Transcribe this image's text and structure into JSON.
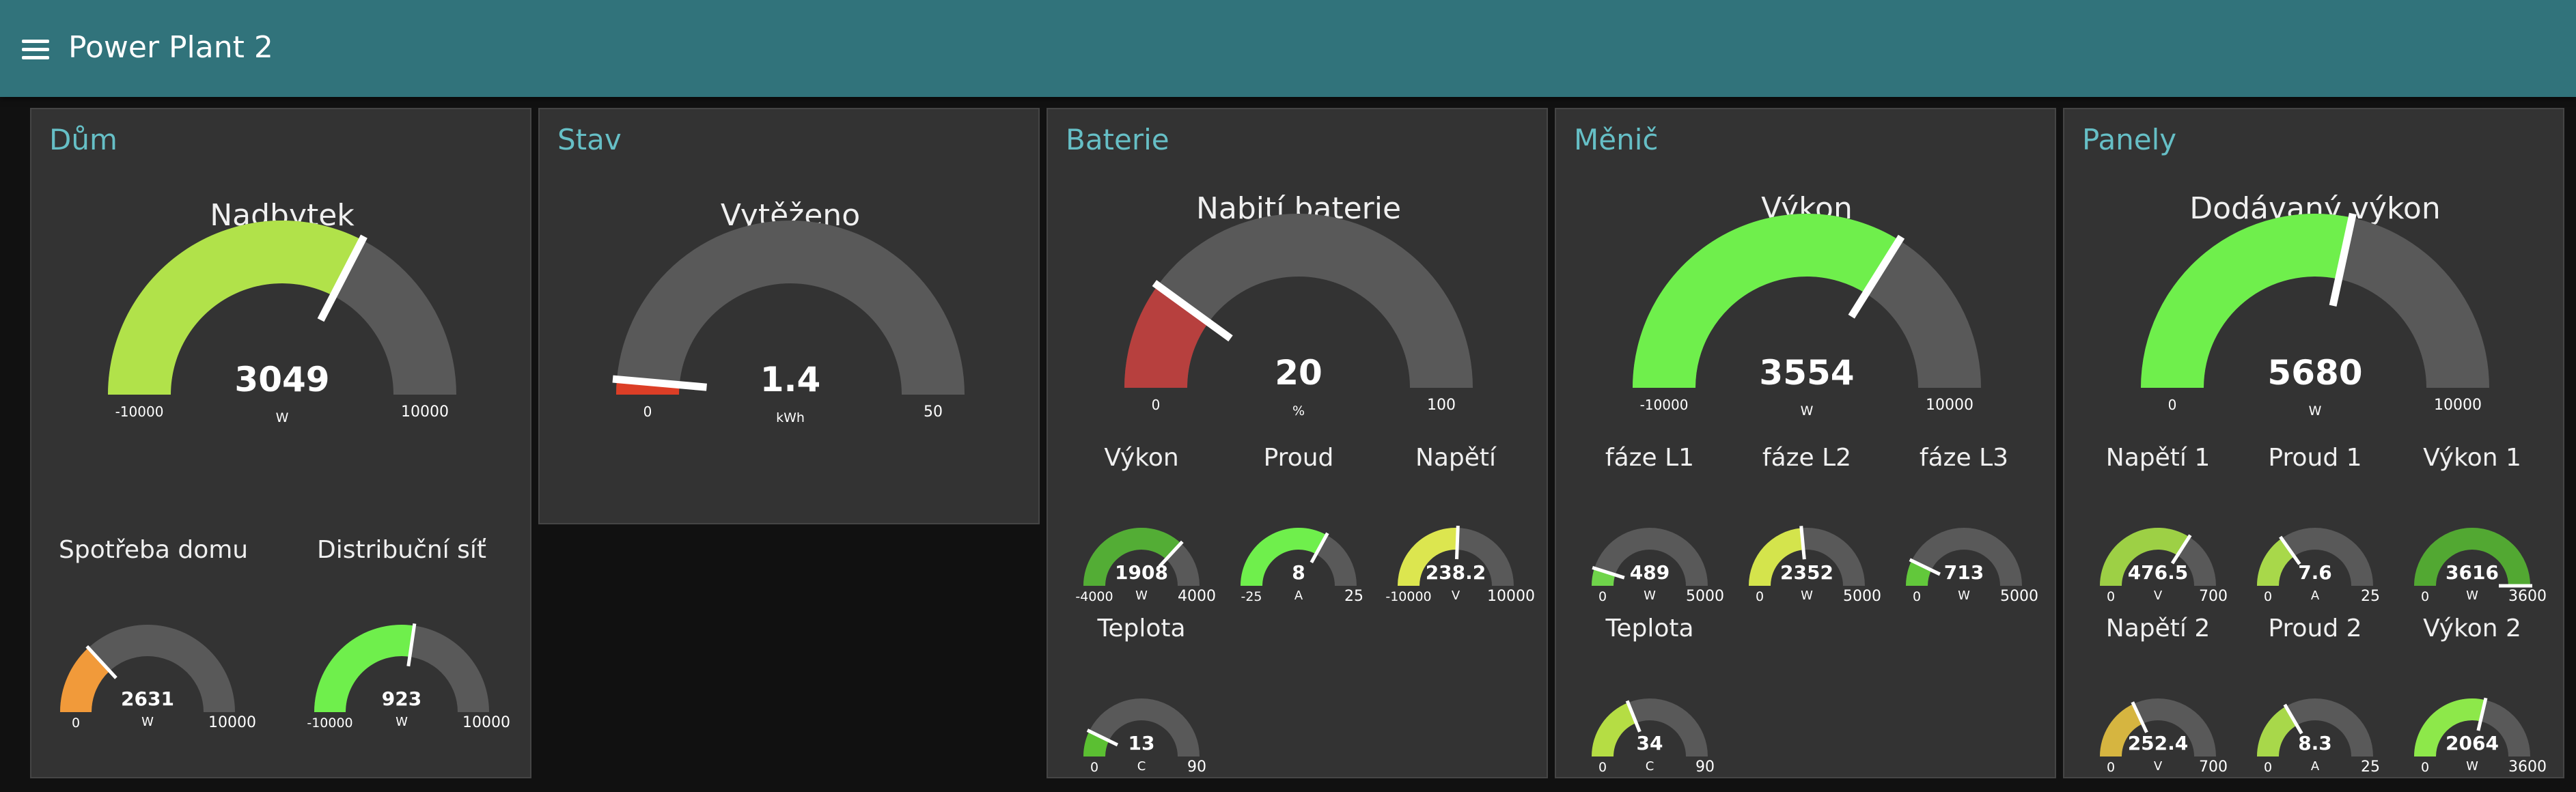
{
  "app": {
    "title": "Power Plant 2"
  },
  "groups": [
    {
      "title": "Dům",
      "gauges": [
        {
          "title": "Nadbytek",
          "value": "3049",
          "unit": "W",
          "min": "-10000",
          "max": "10000",
          "fraction": 0.652,
          "color": "#b1e24a"
        },
        {
          "title": "Spotřeba domu",
          "value": "2631",
          "unit": "W",
          "min": "0",
          "max": "10000",
          "fraction": 0.263,
          "color": "#f19a3a"
        },
        {
          "title": "Distribuční síť",
          "value": "923",
          "unit": "W",
          "min": "-10000",
          "max": "10000",
          "fraction": 0.546,
          "color": "#6fef4c"
        }
      ]
    },
    {
      "title": "Stav",
      "gauges": [
        {
          "title": "Vytěženo",
          "value": "1.4",
          "unit": "kWh",
          "min": "0",
          "max": "50",
          "fraction": 0.028,
          "color": "#dc3e26"
        }
      ]
    },
    {
      "title": "Baterie",
      "gauges": [
        {
          "title": "Nabití baterie",
          "value": "20",
          "unit": "%",
          "min": "0",
          "max": "100",
          "fraction": 0.2,
          "color": "#b7403e"
        },
        {
          "title": "Výkon",
          "value": "1908",
          "unit": "W",
          "min": "-4000",
          "max": "4000",
          "fraction": 0.738,
          "color": "#53ad35"
        },
        {
          "title": "Proud",
          "value": "8",
          "unit": "A",
          "min": "-25",
          "max": "25",
          "fraction": 0.66,
          "color": "#6fef4c"
        },
        {
          "title": "Napětí",
          "value": "238.2",
          "unit": "V",
          "min": "-10000",
          "max": "10000",
          "fraction": 0.512,
          "color": "#dce64f"
        },
        {
          "title": "Teplota",
          "value": "13",
          "unit": "C",
          "min": "0",
          "max": "90",
          "fraction": 0.144,
          "color": "#5bbf32"
        }
      ]
    },
    {
      "title": "Měnič",
      "gauges": [
        {
          "title": "Výkon",
          "value": "3554",
          "unit": "W",
          "min": "-10000",
          "max": "10000",
          "fraction": 0.678,
          "color": "#6fef4c"
        },
        {
          "title": "fáze L1",
          "value": "489",
          "unit": "W",
          "min": "0",
          "max": "5000",
          "fraction": 0.098,
          "color": "#6fd44a"
        },
        {
          "title": "fáze L2",
          "value": "2352",
          "unit": "W",
          "min": "0",
          "max": "5000",
          "fraction": 0.47,
          "color": "#d4e44c"
        },
        {
          "title": "fáze L3",
          "value": "713",
          "unit": "W",
          "min": "0",
          "max": "5000",
          "fraction": 0.143,
          "color": "#62c83b"
        },
        {
          "title": "Teplota",
          "value": "34",
          "unit": "C",
          "min": "0",
          "max": "90",
          "fraction": 0.378,
          "color": "#b5dd44"
        }
      ]
    },
    {
      "title": "Panely",
      "gauges": [
        {
          "title": "Dodávaný výkon",
          "value": "5680",
          "unit": "W",
          "min": "0",
          "max": "10000",
          "fraction": 0.568,
          "color": "#6fef4c"
        },
        {
          "title": "Napětí 1",
          "value": "476.5",
          "unit": "V",
          "min": "0",
          "max": "700",
          "fraction": 0.681,
          "color": "#9dd045"
        },
        {
          "title": "Proud 1",
          "value": "7.6",
          "unit": "A",
          "min": "0",
          "max": "25",
          "fraction": 0.304,
          "color": "#a8d84a"
        },
        {
          "title": "Výkon 1",
          "value": "3616",
          "unit": "W",
          "min": "0",
          "max": "3600",
          "fraction": 1.0,
          "color": "#52a832"
        },
        {
          "title": "Napětí 2",
          "value": "252.4",
          "unit": "V",
          "min": "0",
          "max": "700",
          "fraction": 0.361,
          "color": "#d6b540"
        },
        {
          "title": "Proud 2",
          "value": "8.3",
          "unit": "A",
          "min": "0",
          "max": "25",
          "fraction": 0.332,
          "color": "#a8d84a"
        },
        {
          "title": "Výkon 2",
          "value": "2064",
          "unit": "W",
          "min": "0",
          "max": "3600",
          "fraction": 0.573,
          "color": "#8de84a"
        }
      ]
    }
  ]
}
